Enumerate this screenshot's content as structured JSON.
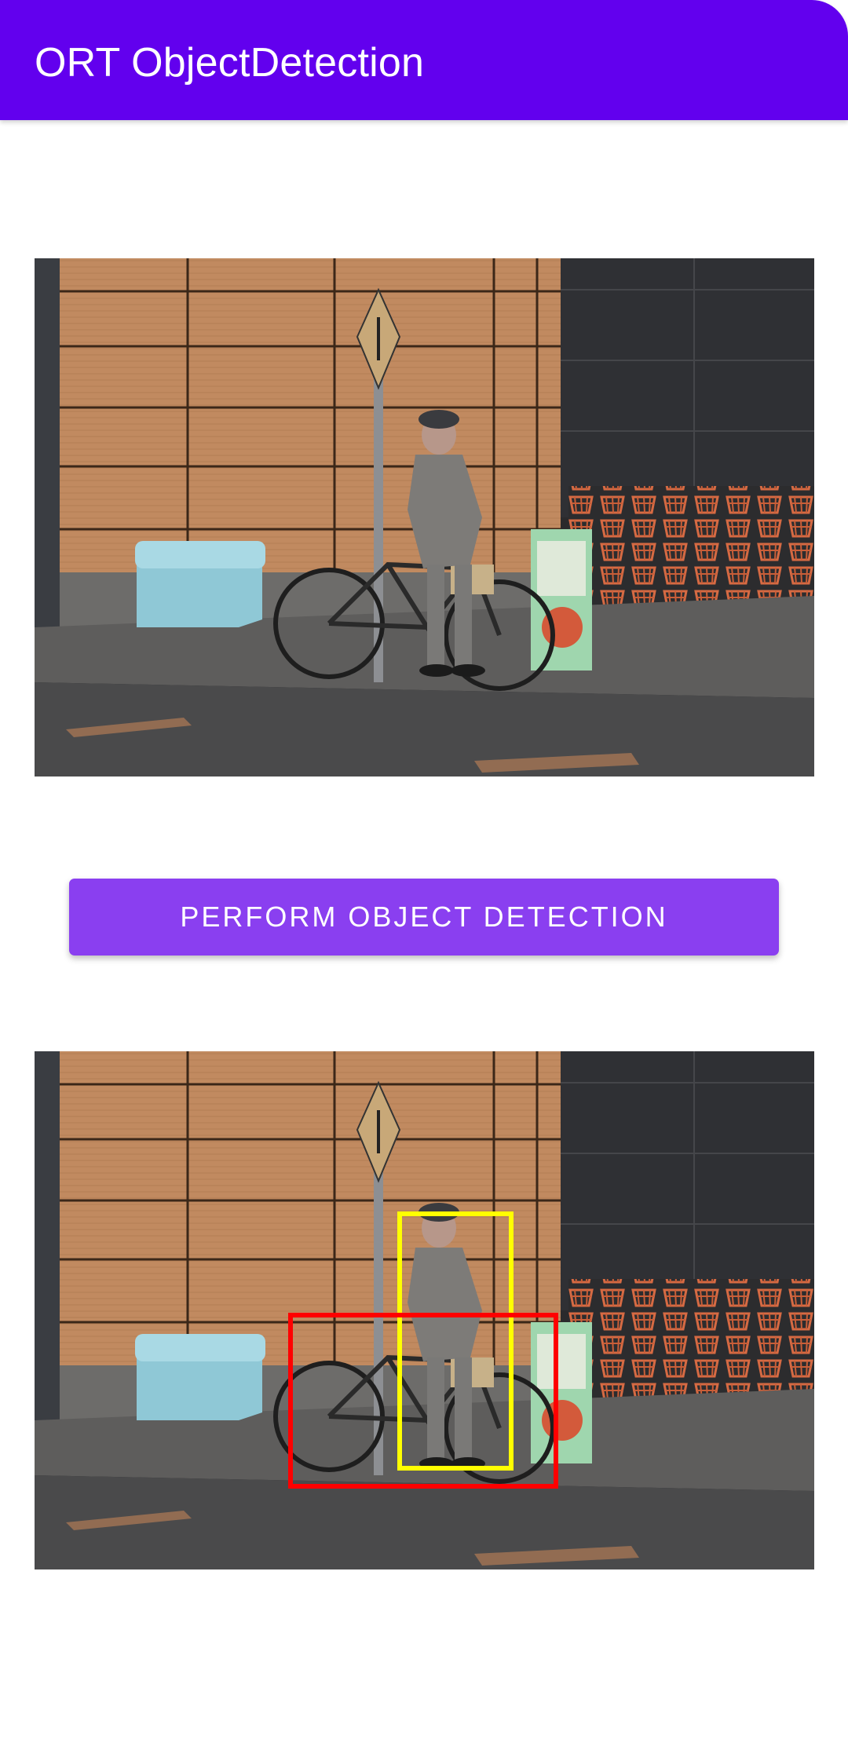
{
  "app_bar": {
    "title": "ORT ObjectDetection",
    "color": "#6200ee"
  },
  "input_image": {
    "icon": "street-scene-photo"
  },
  "actions": {
    "detect_label": "Perform Object Detection",
    "color": "#8a3ff0"
  },
  "output_image": {
    "icon": "street-scene-photo-with-detections",
    "detection_colors": [
      "#ffff00",
      "#ff0000"
    ]
  }
}
